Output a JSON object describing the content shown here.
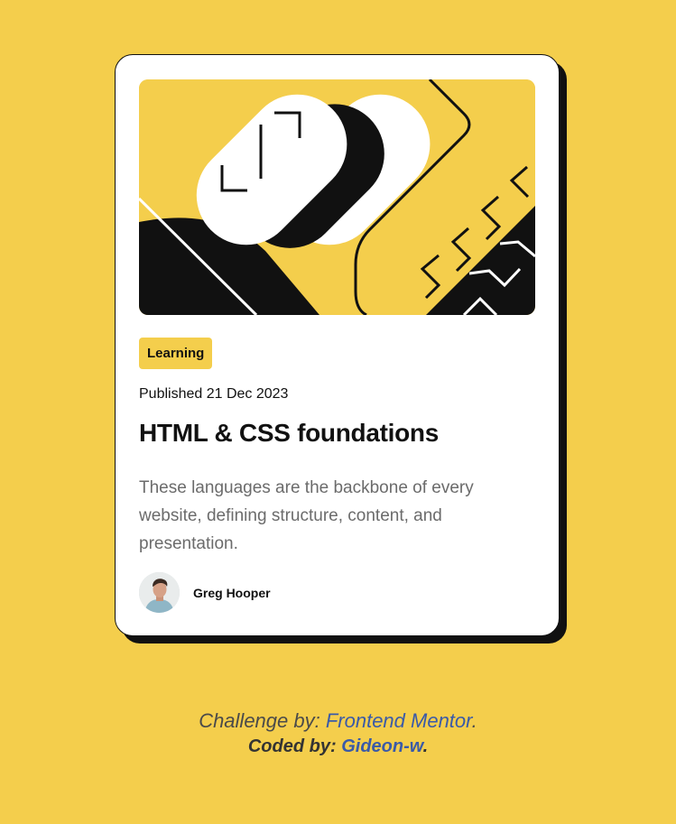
{
  "card": {
    "tag": "Learning",
    "published": "Published 21 Dec 2023",
    "title": "HTML & CSS foundations",
    "description": "These languages are the backbone of every website, defining structure, content, and presentation.",
    "author": "Greg Hooper"
  },
  "attribution": {
    "challenge_prefix": "Challenge by: ",
    "challenge_link": "Frontend Mentor",
    "challenge_suffix": ".",
    "coded_prefix": "Coded by: ",
    "coded_link": "Gideon-w",
    "coded_suffix": "."
  },
  "colors": {
    "background": "#F4CE4C",
    "card": "#FFFFFF",
    "ink": "#111111",
    "muted_text": "#6B6B6B",
    "link": "#3A5AA8"
  },
  "icons": {
    "avatar": "person-portrait"
  }
}
